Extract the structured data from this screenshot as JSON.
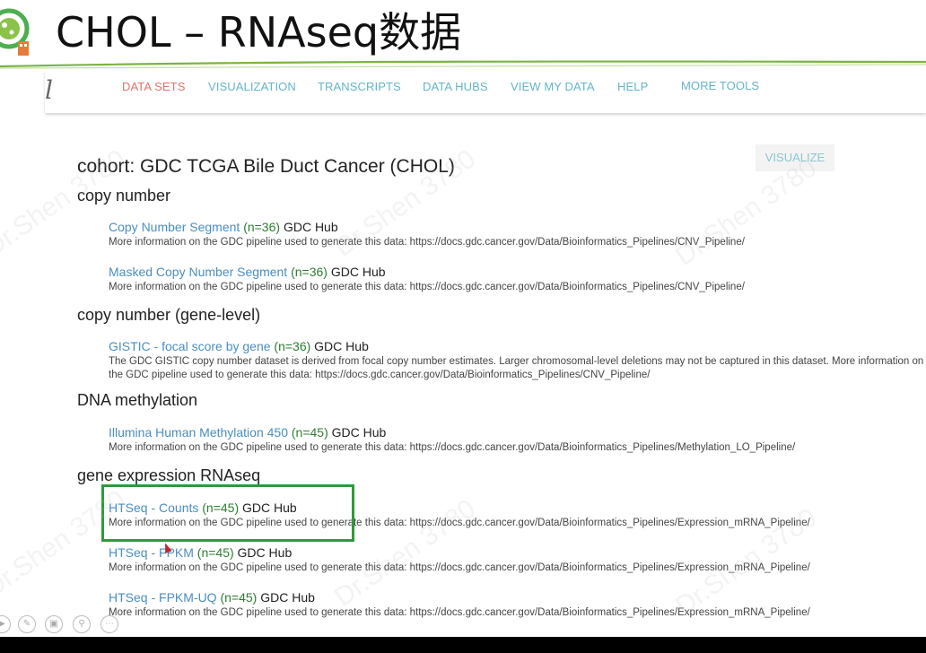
{
  "slide": {
    "title": "CHOL – RNAseq数据"
  },
  "nav": {
    "items": [
      {
        "label": "DATA SETS",
        "active": true
      },
      {
        "label": "VISUALIZATION",
        "active": false
      },
      {
        "label": "TRANSCRIPTS",
        "active": false
      },
      {
        "label": "DATA HUBS",
        "active": false
      },
      {
        "label": "VIEW MY DATA",
        "active": false
      },
      {
        "label": "HELP",
        "active": false
      },
      {
        "label": "MORE TOOLS",
        "active": false
      }
    ]
  },
  "visualize_button": "VISUALIZE",
  "cohort_title": "cohort: GDC TCGA Bile Duct Cancer (CHOL)",
  "sections": [
    {
      "heading": "copy number",
      "datasets": [
        {
          "name": "Copy Number Segment",
          "count": "(n=36)",
          "hub": "GDC Hub",
          "desc": "More information on the GDC pipeline used to generate this data: https://docs.gdc.cancer.gov/Data/Bioinformatics_Pipelines/CNV_Pipeline/"
        },
        {
          "name": "Masked Copy Number Segment",
          "count": "(n=36)",
          "hub": "GDC Hub",
          "desc": "More information on the GDC pipeline used to generate this data: https://docs.gdc.cancer.gov/Data/Bioinformatics_Pipelines/CNV_Pipeline/"
        }
      ]
    },
    {
      "heading": "copy number (gene-level)",
      "datasets": [
        {
          "name": "GISTIC - focal score by gene",
          "count": "(n=36)",
          "hub": "GDC Hub",
          "desc": "The GDC GISTIC copy number dataset is derived from focal copy number estimates. Larger chromosomal-level deletions may not be captured in this dataset. More information on the GDC pipeline used to generate this data: https://docs.gdc.cancer.gov/Data/Bioinformatics_Pipelines/CNV_Pipeline/"
        }
      ]
    },
    {
      "heading": "DNA methylation",
      "datasets": [
        {
          "name": "Illumina Human Methylation 450",
          "count": "(n=45)",
          "hub": "GDC Hub",
          "desc": "More information on the GDC pipeline used to generate this data: https://docs.gdc.cancer.gov/Data/Bioinformatics_Pipelines/Methylation_LO_Pipeline/"
        }
      ]
    },
    {
      "heading": "gene expression RNAseq",
      "datasets": [
        {
          "name": "HTSeq - Counts",
          "count": "(n=45)",
          "hub": "GDC Hub",
          "desc": "More information on the GDC pipeline used to generate this data: https://docs.gdc.cancer.gov/Data/Bioinformatics_Pipelines/Expression_mRNA_Pipeline/"
        },
        {
          "name": "HTSeq - FPKM",
          "count": "(n=45)",
          "hub": "GDC Hub",
          "desc": "More information on the GDC pipeline used to generate this data: https://docs.gdc.cancer.gov/Data/Bioinformatics_Pipelines/Expression_mRNA_Pipeline/"
        },
        {
          "name": "HTSeq - FPKM-UQ",
          "count": "(n=45)",
          "hub": "GDC Hub",
          "desc": "More information on the GDC pipeline used to generate this data: https://docs.gdc.cancer.gov/Data/Bioinformatics_Pipelines/Expression_mRNA_Pipeline/"
        }
      ]
    }
  ],
  "watermark_text": "Dr.Shen 3780",
  "colors": {
    "nav_active": "#e0716b",
    "nav_link": "#64b4c8",
    "dataset_link": "#4a8ec2",
    "count": "#2e7d32",
    "highlight": "#2e9b3a"
  },
  "player_icons": [
    "play-icon",
    "pen-icon",
    "copy-icon",
    "zoom-icon",
    "more-icon"
  ]
}
